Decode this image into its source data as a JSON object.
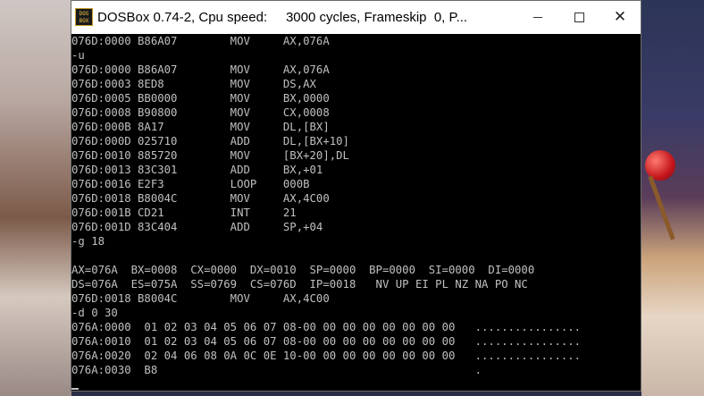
{
  "window": {
    "title": "DOSBox 0.74-2, Cpu speed:     3000 cycles, Frameskip  0, P...",
    "icon_text": "DOS BOX",
    "icons": {
      "app": "dosbox-icon",
      "minimize": "minimize-icon",
      "maximize": "maximize-icon",
      "close": "close-icon"
    },
    "close_glyph": "✕"
  },
  "console": {
    "lines": [
      "076D:0000 B86A07        MOV     AX,076A",
      "-u",
      "076D:0000 B86A07        MOV     AX,076A",
      "076D:0003 8ED8          MOV     DS,AX",
      "076D:0005 BB0000        MOV     BX,0000",
      "076D:0008 B90800        MOV     CX,0008",
      "076D:000B 8A17          MOV     DL,[BX]",
      "076D:000D 025710        ADD     DL,[BX+10]",
      "076D:0010 885720        MOV     [BX+20],DL",
      "076D:0013 83C301        ADD     BX,+01",
      "076D:0016 E2F3          LOOP    000B",
      "076D:0018 B8004C        MOV     AX,4C00",
      "076D:001B CD21          INT     21",
      "076D:001D 83C404        ADD     SP,+04",
      "-g 18",
      "",
      "AX=076A  BX=0008  CX=0000  DX=0010  SP=0000  BP=0000  SI=0000  DI=0000",
      "DS=076A  ES=075A  SS=0769  CS=076D  IP=0018   NV UP EI PL NZ NA PO NC",
      "076D:0018 B8004C        MOV     AX,4C00",
      "-d 0 30",
      "076A:0000  01 02 03 04 05 06 07 08-00 00 00 00 00 00 00 00   ................",
      "076A:0010  01 02 03 04 05 06 07 08-00 00 00 00 00 00 00 00   ................",
      "076A:0020  02 04 06 08 0A 0C 0E 10-00 00 00 00 00 00 00 00   ................",
      "076A:0030  B8                                                .",
      ""
    ]
  }
}
